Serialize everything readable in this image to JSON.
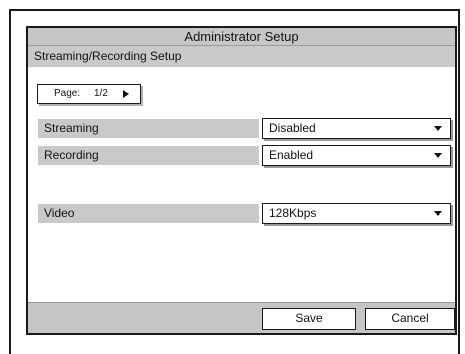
{
  "window": {
    "title": "Administrator Setup"
  },
  "section": {
    "title": "Streaming/Recording Setup"
  },
  "pager": {
    "label": "Page:",
    "value": "1/2"
  },
  "settings": [
    {
      "label": "Streaming",
      "value": "Disabled"
    },
    {
      "label": "Recording",
      "value": "Enabled"
    },
    {
      "label": "Video",
      "value": "128Kbps"
    }
  ],
  "actions": {
    "save_label": "Save",
    "cancel_label": "Cancel"
  },
  "colors": {
    "panel_gray": "#c9c9c9",
    "border": "#1a1a1a",
    "background": "#ffffff"
  },
  "icons": {
    "pager_arrow": "triangle-right-icon",
    "dropdown_arrow": "triangle-down-icon"
  }
}
